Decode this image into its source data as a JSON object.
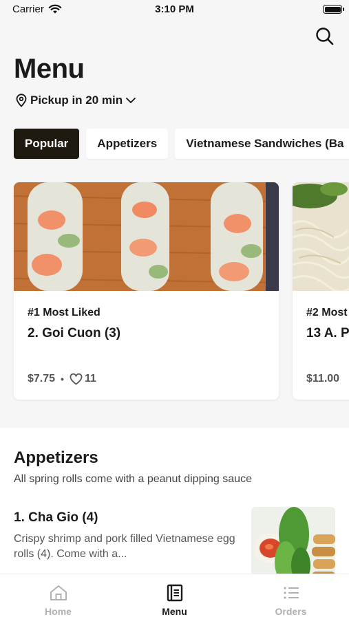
{
  "status_bar": {
    "carrier": "Carrier",
    "time": "3:10 PM"
  },
  "header": {
    "title": "Menu",
    "pickup": "Pickup in 20 min"
  },
  "categories": [
    {
      "label": "Popular",
      "active": true
    },
    {
      "label": "Appetizers",
      "active": false
    },
    {
      "label": "Vietnamese Sandwiches (Ba",
      "active": false
    }
  ],
  "popular_cards": [
    {
      "rank": "#1 Most Liked",
      "name": "2. Goi Cuon (3)",
      "price": "$7.75",
      "separator": "•",
      "likes": "11"
    },
    {
      "rank": "#2 Most",
      "name": "13 A. P",
      "price": "$11.00"
    }
  ],
  "section": {
    "title": "Appetizers",
    "description": "All spring rolls come with a peanut dipping sauce",
    "items": [
      {
        "name": "1. Cha Gio (4)",
        "description": "Crispy shrimp and pork filled Vietnamese egg rolls (4). Come with a..."
      }
    ]
  },
  "tabbar": [
    {
      "label": "Home",
      "icon": "home-icon",
      "active": false
    },
    {
      "label": "Menu",
      "icon": "menu-book-icon",
      "active": true
    },
    {
      "label": "Orders",
      "icon": "list-icon",
      "active": false
    }
  ],
  "colors": {
    "active_chip": "#1e1a0f",
    "background": "#f6f6f6",
    "inactive_tab": "#b0b0b0"
  }
}
